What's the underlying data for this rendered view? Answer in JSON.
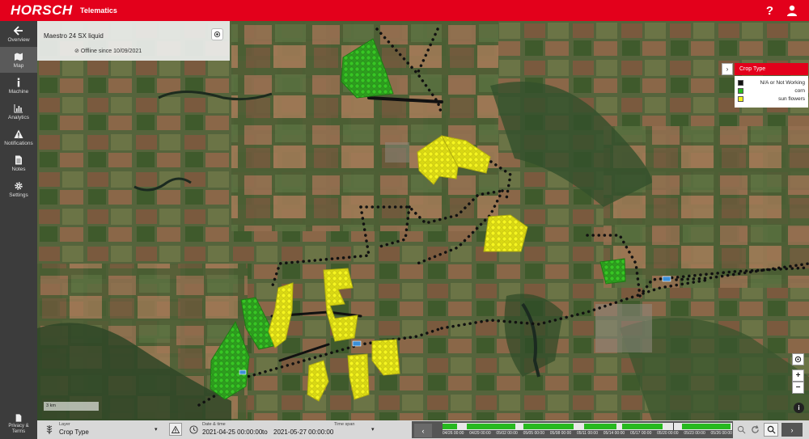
{
  "header": {
    "brand": "HORSCH",
    "app": "Telematics",
    "help": "?"
  },
  "sidebar": {
    "items": [
      {
        "label": "Overview",
        "icon": "arrow-left-icon"
      },
      {
        "label": "Map",
        "icon": "map-icon"
      },
      {
        "label": "Machine",
        "icon": "info-icon"
      },
      {
        "label": "Analytics",
        "icon": "bar-chart-icon"
      },
      {
        "label": "Notifications",
        "icon": "warning-icon"
      },
      {
        "label": "Notes",
        "icon": "note-icon"
      },
      {
        "label": "Settings",
        "icon": "gear-icon"
      }
    ],
    "privacy": {
      "line1": "Privacy &",
      "line2": "Terms"
    }
  },
  "machine": {
    "name": "Maestro 24 SX liquid",
    "status": "Offline since 10/09/2021"
  },
  "legend": {
    "title": "Crop Type",
    "items": [
      {
        "label": "N/A or Not Working",
        "color": "#111111"
      },
      {
        "label": "corn",
        "color": "#27b91f"
      },
      {
        "label": "sun flowers",
        "color": "#f2f21c"
      }
    ]
  },
  "map": {
    "scale": "3 km",
    "zoom_in": "+",
    "zoom_out": "−"
  },
  "bottom": {
    "layer_label": "Layer",
    "layer_value": "Crop Type",
    "datetime_label": "Date & time",
    "from": "2021-04-25 00:00:00",
    "to_label": "to",
    "to": "2021-05-27 00:00:00",
    "timespan_label": "Time span",
    "timeline_dates": [
      "04/26 00:00",
      "04/29 00:00",
      "05/02 00:00",
      "05/05 00:00",
      "05/08 00:00",
      "05/11 00:00",
      "05/14 00:00",
      "05/17 00:00",
      "05/20 00:00",
      "05/23 00:00",
      "05/26 00:00"
    ]
  },
  "colors": {
    "brand_red": "#e3001b",
    "corn": "#27b91f",
    "sunflower": "#f2f21c",
    "track": "#111111"
  }
}
